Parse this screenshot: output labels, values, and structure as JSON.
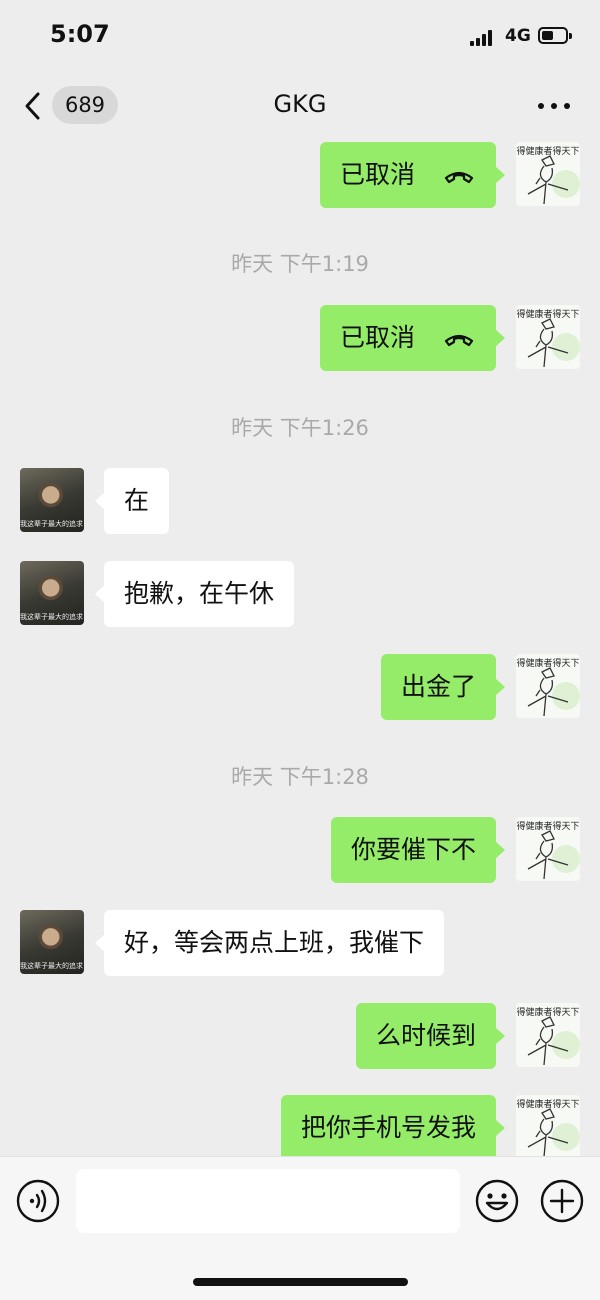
{
  "status_bar": {
    "time": "5:07",
    "network": "4G"
  },
  "nav": {
    "unread_count": "689",
    "title": "GKG"
  },
  "self_avatar_caption": "得健康者得天下",
  "other_avatar_caption": "我这辈子最大的追求 就是让每个人都吃饱",
  "messages": [
    {
      "text": "已取消"
    },
    {
      "time": "昨天 下午1:19"
    },
    {
      "text": "已取消"
    },
    {
      "time": "昨天 下午1:26"
    },
    {
      "text": "在"
    },
    {
      "text": "抱歉，在午休"
    },
    {
      "text": "出金了"
    },
    {
      "time": "昨天 下午1:28"
    },
    {
      "text": "你要催下不"
    },
    {
      "text": "好，等会两点上班，我催下"
    },
    {
      "text": "么时候到"
    },
    {
      "text": "把你手机号发我"
    }
  ],
  "input": {
    "placeholder": ""
  },
  "colors": {
    "outgoing_bubble": "#95ec69",
    "incoming_bubble": "#ffffff",
    "background": "#ededed"
  }
}
